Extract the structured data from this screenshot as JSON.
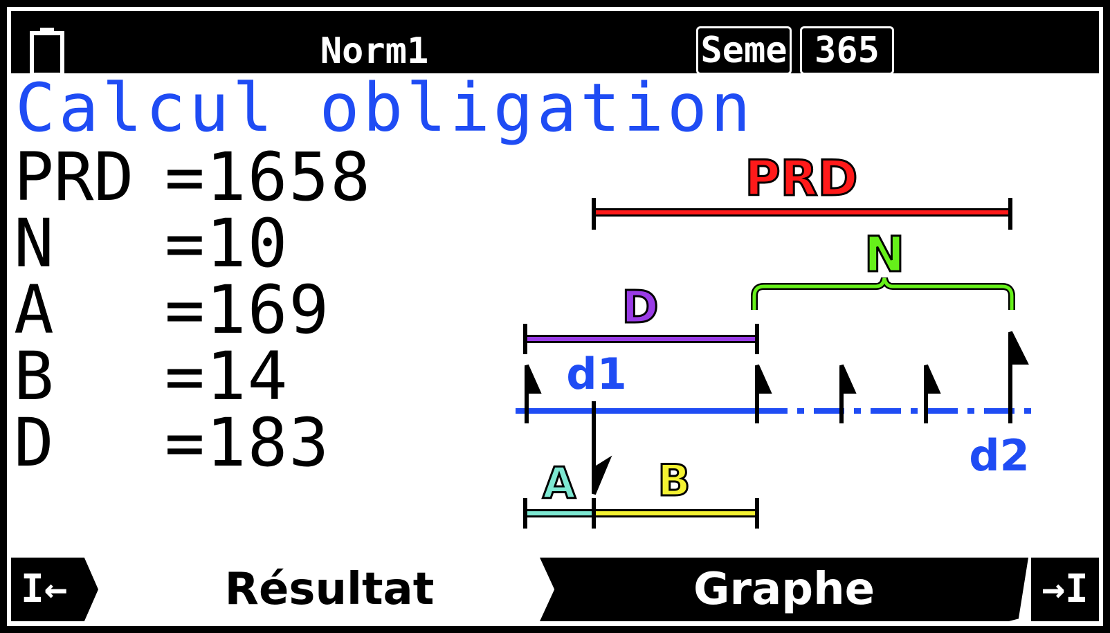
{
  "status": {
    "battery_icon": "battery-icon",
    "mode": "Norm1",
    "days_basis": "Seme",
    "days_count": "365"
  },
  "title": "Calcul obligation",
  "results": [
    {
      "label": "PRD",
      "value": "=1658"
    },
    {
      "label": "N",
      "value": "=10"
    },
    {
      "label": "A",
      "value": "=169"
    },
    {
      "label": "B",
      "value": "=14"
    },
    {
      "label": "D",
      "value": "=183"
    }
  ],
  "diagram": {
    "prd_label": "PRD",
    "n_label": "N",
    "d_label": "D",
    "d1_label": "d1",
    "d2_label": "d2",
    "a_label": "A",
    "b_label": "B",
    "colors": {
      "prd": "#ff1a1a",
      "n": "#66f01a",
      "d": "#9a3ce6",
      "a": "#7de8d2",
      "b": "#f4f232",
      "timeline": "#1f4cf4"
    }
  },
  "softkeys": {
    "prev_icon": "first-page-icon",
    "prev": "I←",
    "result": "Résultat",
    "graph": "Graphe",
    "next_icon": "last-page-icon",
    "next": "→I"
  }
}
